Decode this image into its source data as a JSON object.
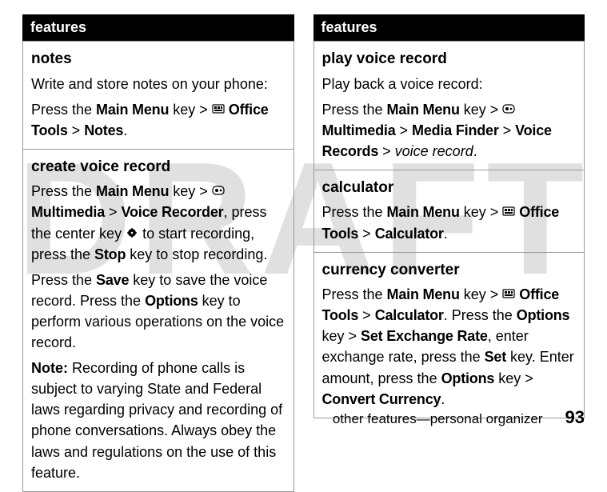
{
  "watermark": "DRAFT",
  "left": {
    "header": "features",
    "notes": {
      "title": "notes",
      "line1": "Write and store notes on your phone:",
      "press": "Press the ",
      "mainmenu": "Main Menu",
      "key_gt": " key > ",
      "office_tools": "Office Tools",
      "gt": " > ",
      "notes_label": "Notes",
      "period": "."
    },
    "create": {
      "title": "create voice record",
      "press": "Press the ",
      "mainmenu": "Main Menu",
      "key_gt": " key > ",
      "multimedia": "Multimedia",
      "gt": " > ",
      "voice_recorder": "Voice Recorder",
      "mid1": ", press the center key ",
      "mid2": " to start recording, press the ",
      "stop": "Stop",
      "mid3": " key to stop recording.",
      "p2a": "Press the ",
      "save": "Save",
      "p2b": " key to save the voice record. Press the ",
      "options": "Options",
      "p2c": " key to perform various operations on the voice record.",
      "note_label": "Note:",
      "note_body": " Recording of phone calls is subject to varying State and Federal laws regarding privacy and recording of phone conversations. Always obey the laws and regulations on the use of this feature."
    }
  },
  "right": {
    "header": "features",
    "play": {
      "title": "play voice record",
      "line1": "Play back a voice record:",
      "press": "Press the ",
      "mainmenu": "Main Menu",
      "key_gt": " key > ",
      "multimedia": "Multimedia",
      "gt1": " > ",
      "media_finder": "Media Finder",
      "gt2": " > ",
      "voice_records": "Voice Records",
      "gt3": " > ",
      "voice_record_item": "voice record",
      "period": "."
    },
    "calculator": {
      "title": "calculator",
      "press": "Press the ",
      "mainmenu": "Main Menu",
      "key_gt": " key > ",
      "office_tools": "Office Tools",
      "gt": " > ",
      "calc": "Calculator",
      "period": "."
    },
    "currency": {
      "title": "currency converter",
      "press": "Press the ",
      "mainmenu": "Main Menu",
      "key_gt": " key > ",
      "office_tools": "Office Tools",
      "gt1": " > ",
      "calc": "Calculator",
      "mid1": ". Press the ",
      "options": "Options",
      "mid2": " key > ",
      "set_rate": "Set Exchange Rate",
      "mid3": ", enter exchange rate, press the ",
      "set": "Set",
      "mid4": " key. Enter amount, press the ",
      "options2": "Options",
      "mid5": " key > ",
      "convert": "Convert Currency",
      "period": "."
    }
  },
  "footer": {
    "label": "other features—personal organizer",
    "page": "93"
  }
}
